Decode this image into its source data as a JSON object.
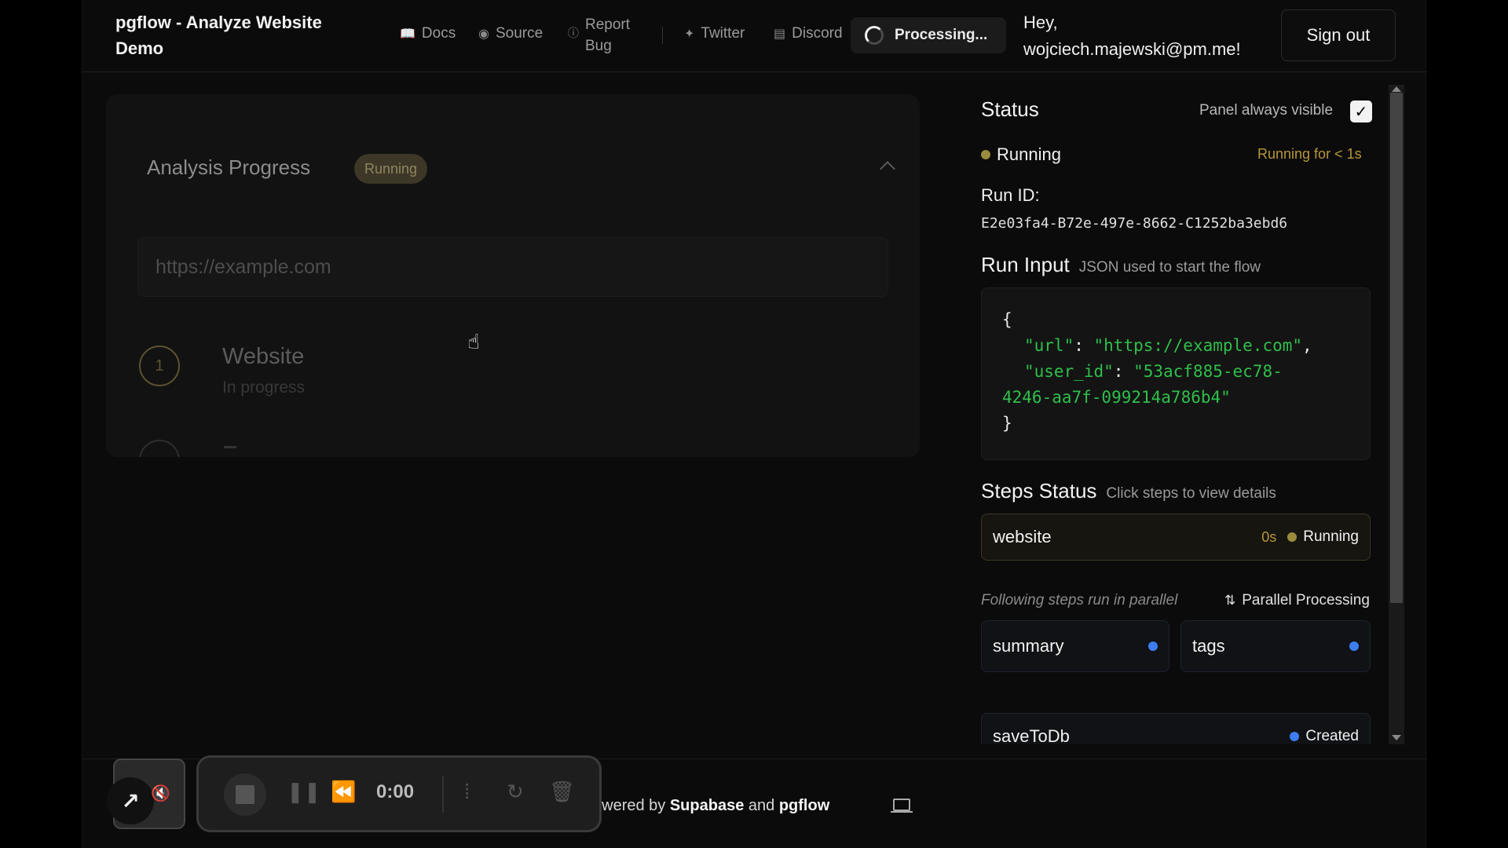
{
  "header": {
    "app_title": "pgflow - Analyze Website Demo",
    "nav": [
      {
        "label": "Docs",
        "icon": "book-icon"
      },
      {
        "label": "Source",
        "icon": "github-icon"
      },
      {
        "label": "Report Bug",
        "icon": "info-icon"
      },
      {
        "label": "Twitter",
        "icon": "twitter-icon"
      },
      {
        "label": "Discord",
        "icon": "chat-icon"
      }
    ],
    "processing_label": "Processing...",
    "greeting": "Hey, wojciech.majewski@pm.me!",
    "signout_label": "Sign out"
  },
  "progress_card": {
    "title": "Analysis Progress",
    "badge": "Running",
    "url_value": "https://example.com",
    "steps": [
      {
        "number": "1",
        "name": "Website",
        "status": "In progress"
      }
    ]
  },
  "status_panel": {
    "title": "Status",
    "panel_visible_label": "Panel always visible",
    "panel_visible_checked": true,
    "state": "Running",
    "running_for": "Running for < 1s",
    "run_id_label": "Run ID:",
    "run_id": "E2e03fa4-B72e-497e-8662-C1252ba3ebd6",
    "run_input_title": "Run Input",
    "run_input_sub": "JSON used to start the flow",
    "json_open": "{",
    "json_close": "}",
    "json_url_key": "\"url\"",
    "json_url_value": "\"https://example.com\"",
    "json_user_key": "\"user_id\"",
    "json_user_value_a": "\"53acf885-ec78-",
    "json_user_value_b": "4246-aa7f-099214a786b4\"",
    "steps_title": "Steps Status",
    "steps_sub": "Click steps to view details",
    "website_step": {
      "name": "website",
      "time": "0s",
      "status": "Running"
    },
    "parallel_note": "Following steps run in parallel",
    "parallel_label": "Parallel Processing",
    "parallel_steps": [
      {
        "name": "summary"
      },
      {
        "name": "tags"
      }
    ],
    "save_step": {
      "name": "saveToDb",
      "status": "Created"
    }
  },
  "footer": {
    "powered_prefix": "owered by",
    "powered_a": "Supabase",
    "powered_and": "and",
    "powered_b": "pgflow"
  },
  "recorder": {
    "time": "0:00"
  },
  "colors": {
    "running_amber": "#9a8a3c",
    "created_blue": "#3d7df0",
    "json_string_green": "#2fbf4b"
  }
}
